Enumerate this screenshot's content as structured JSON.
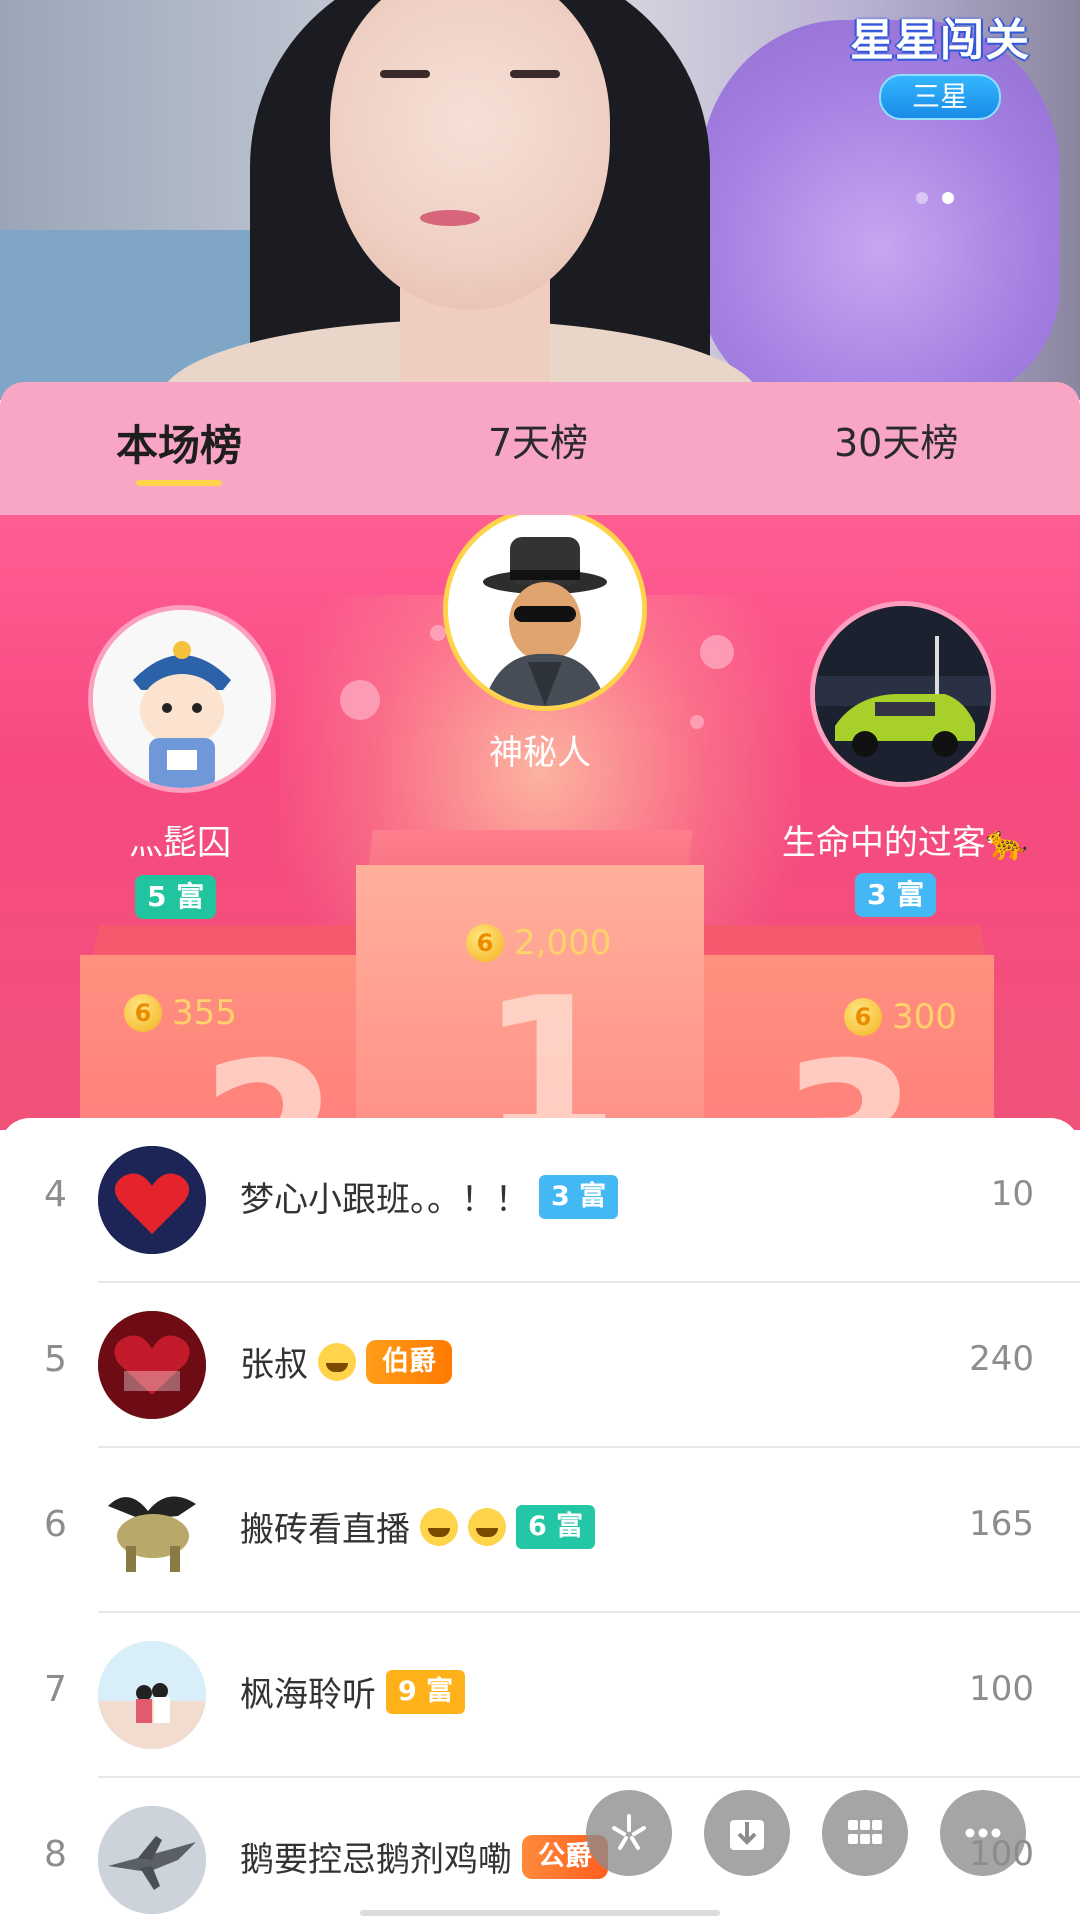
{
  "stream": {
    "game_title": "星星闯关",
    "game_level": "三星",
    "page_count": 2,
    "active_page": 2
  },
  "tabs": [
    {
      "label": "本场榜",
      "active": true
    },
    {
      "label": "7天榜",
      "active": false
    },
    {
      "label": "30天榜",
      "active": false
    }
  ],
  "podium": {
    "first": {
      "name": "神秘人",
      "score": "2,000",
      "rank_num": "1"
    },
    "second": {
      "name": "灬髭囚",
      "score": "355",
      "rank_num": "2",
      "wealth": "5 富"
    },
    "third": {
      "name": "生命中的过客🐆",
      "score": "300",
      "rank_num": "3",
      "wealth": "3 富"
    },
    "coin_glyph": "6"
  },
  "ranking": [
    {
      "rank": "4",
      "name": "梦心小跟班。。！！",
      "badge": "3 富",
      "badge_type": "rich3",
      "value": "10"
    },
    {
      "rank": "5",
      "name": "张叔",
      "emoji_count": 1,
      "badge": "伯爵",
      "badge_type": "noble",
      "value": "240"
    },
    {
      "rank": "6",
      "name": "搬砖看直播",
      "emoji_count": 2,
      "badge": "6 富",
      "badge_type": "rich6",
      "value": "165"
    },
    {
      "rank": "7",
      "name": "枫海聆听",
      "badge": "9 富",
      "badge_type": "rich9",
      "value": "100"
    },
    {
      "rank": "8",
      "name": "鹅要控忌鹅剂鸡嘞",
      "badge": "公爵",
      "badge_type": "noble-duke",
      "value": "100"
    }
  ],
  "actions": [
    {
      "icon": "sparkle-icon"
    },
    {
      "icon": "download-icon"
    },
    {
      "icon": "grid-icon"
    },
    {
      "icon": "more-icon"
    }
  ],
  "colors": {
    "tab_bg": "#f9a6c6",
    "podium_bg": "#f64a80",
    "coin": "#f3b11c",
    "rich3": "#43b8f5",
    "rich5": "#20c5a0",
    "rich6": "#23c6a5",
    "rich9": "#ffb11a"
  }
}
